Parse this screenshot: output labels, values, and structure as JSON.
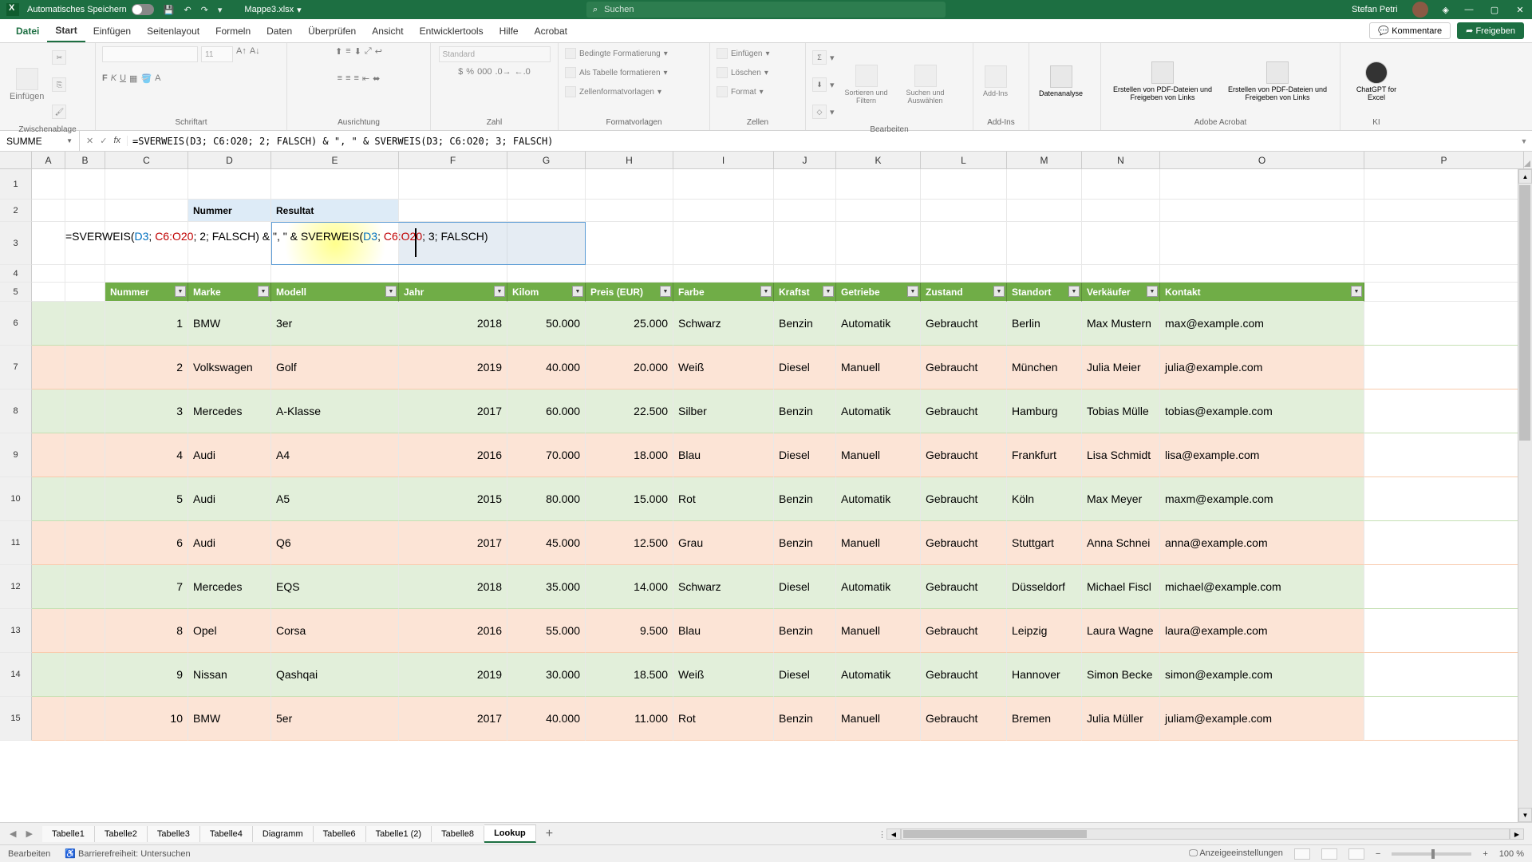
{
  "titlebar": {
    "autosave_label": "Automatisches Speichern",
    "filename": "Mappe3.xlsx",
    "search_placeholder": "Suchen",
    "user": "Stefan Petri"
  },
  "ribbon_tabs": {
    "file": "Datei",
    "start": "Start",
    "einfuegen": "Einfügen",
    "seitenlayout": "Seitenlayout",
    "formeln": "Formeln",
    "daten": "Daten",
    "ueberpruefen": "Überprüfen",
    "ansicht": "Ansicht",
    "entwickler": "Entwicklertools",
    "hilfe": "Hilfe",
    "acrobat": "Acrobat",
    "kommentare": "Kommentare",
    "freigeben": "Freigeben"
  },
  "ribbon": {
    "paste": "Einfügen",
    "group_zwischen": "Zwischenablage",
    "group_schrift": "Schriftart",
    "group_ausrichtung": "Ausrichtung",
    "group_zahl": "Zahl",
    "numfmt": "Standard",
    "fontsize": "11",
    "group_format": "Formatvorlagen",
    "cond1": "Bedingte Formatierung",
    "cond2": "Als Tabelle formatieren",
    "cond3": "Zellenformatvorlagen",
    "cells_ins": "Einfügen",
    "cells_del": "Löschen",
    "cells_fmt": "Format",
    "group_zellen": "Zellen",
    "sort": "Sortieren und Filtern",
    "find": "Suchen und Auswählen",
    "addins": "Add-Ins",
    "group_bearbeiten": "Bearbeiten",
    "group_addins": "Add-Ins",
    "dataanalyse": "Datenanalyse",
    "pdf1": "Erstellen von PDF-Dateien und Freigeben von Links",
    "pdf2": "Erstellen von PDF-Dateien und Freigeben von Links",
    "group_adobe": "Adobe Acrobat",
    "chatgpt": "ChatGPT for Excel",
    "group_ki": "KI"
  },
  "formula_row": {
    "name_box": "SUMME",
    "formula": "=SVERWEIS(D3; C6:O20; 2; FALSCH) & \", \" & SVERWEIS(D3; C6:O20; 3; FALSCH)"
  },
  "col_letters": [
    "A",
    "B",
    "C",
    "D",
    "E",
    "F",
    "G",
    "H",
    "I",
    "J",
    "K",
    "L",
    "M",
    "N",
    "O",
    "P"
  ],
  "row_headers": {
    "r2_d": "Nummer",
    "r2_e": "Resultat"
  },
  "formula_tokens": {
    "p1": "=SVERWEIS(",
    "d3a": "D3",
    "p2": "; ",
    "r1": "C6:O20",
    "p3": "; 2; FALSCH) & \", \" & SVERWEIS(",
    "d3b": "D3",
    "p4": "; ",
    "r2": "C6:O20",
    "p5": "; 3; FALSCH)"
  },
  "table_headers": {
    "c": "Nummer",
    "d": "Marke",
    "e": "Modell",
    "f": "Jahr",
    "g": "Kilom",
    "h": "Preis (EUR)",
    "i": "Farbe",
    "j": "Kraftst",
    "k": "Getriebe",
    "l": "Zustand",
    "m": "Standort",
    "n": "Verkäufer",
    "o": "Kontakt"
  },
  "table": [
    {
      "n": "1",
      "marke": "BMW",
      "modell": "3er",
      "jahr": "2018",
      "km": "50.000",
      "preis": "25.000",
      "farbe": "Schwarz",
      "kraft": "Benzin",
      "getriebe": "Automatik",
      "zustand": "Gebraucht",
      "ort": "Berlin",
      "verk": "Max Mustern",
      "kontakt": "max@example.com"
    },
    {
      "n": "2",
      "marke": "Volkswagen",
      "modell": "Golf",
      "jahr": "2019",
      "km": "40.000",
      "preis": "20.000",
      "farbe": "Weiß",
      "kraft": "Diesel",
      "getriebe": "Manuell",
      "zustand": "Gebraucht",
      "ort": "München",
      "verk": "Julia Meier",
      "kontakt": "julia@example.com"
    },
    {
      "n": "3",
      "marke": "Mercedes",
      "modell": "A-Klasse",
      "jahr": "2017",
      "km": "60.000",
      "preis": "22.500",
      "farbe": "Silber",
      "kraft": "Benzin",
      "getriebe": "Automatik",
      "zustand": "Gebraucht",
      "ort": "Hamburg",
      "verk": "Tobias Mülle",
      "kontakt": "tobias@example.com"
    },
    {
      "n": "4",
      "marke": "Audi",
      "modell": "A4",
      "jahr": "2016",
      "km": "70.000",
      "preis": "18.000",
      "farbe": "Blau",
      "kraft": "Diesel",
      "getriebe": "Manuell",
      "zustand": "Gebraucht",
      "ort": "Frankfurt",
      "verk": "Lisa Schmidt",
      "kontakt": "lisa@example.com"
    },
    {
      "n": "5",
      "marke": "Audi",
      "modell": "A5",
      "jahr": "2015",
      "km": "80.000",
      "preis": "15.000",
      "farbe": "Rot",
      "kraft": "Benzin",
      "getriebe": "Automatik",
      "zustand": "Gebraucht",
      "ort": "Köln",
      "verk": "Max Meyer",
      "kontakt": "maxm@example.com"
    },
    {
      "n": "6",
      "marke": "Audi",
      "modell": "Q6",
      "jahr": "2017",
      "km": "45.000",
      "preis": "12.500",
      "farbe": "Grau",
      "kraft": "Benzin",
      "getriebe": "Manuell",
      "zustand": "Gebraucht",
      "ort": "Stuttgart",
      "verk": "Anna Schnei",
      "kontakt": "anna@example.com"
    },
    {
      "n": "7",
      "marke": "Mercedes",
      "modell": "EQS",
      "jahr": "2018",
      "km": "35.000",
      "preis": "14.000",
      "farbe": "Schwarz",
      "kraft": "Diesel",
      "getriebe": "Automatik",
      "zustand": "Gebraucht",
      "ort": "Düsseldorf",
      "verk": "Michael Fiscl",
      "kontakt": "michael@example.com"
    },
    {
      "n": "8",
      "marke": "Opel",
      "modell": "Corsa",
      "jahr": "2016",
      "km": "55.000",
      "preis": "9.500",
      "farbe": "Blau",
      "kraft": "Benzin",
      "getriebe": "Manuell",
      "zustand": "Gebraucht",
      "ort": "Leipzig",
      "verk": "Laura Wagne",
      "kontakt": "laura@example.com"
    },
    {
      "n": "9",
      "marke": "Nissan",
      "modell": "Qashqai",
      "jahr": "2019",
      "km": "30.000",
      "preis": "18.500",
      "farbe": "Weiß",
      "kraft": "Diesel",
      "getriebe": "Automatik",
      "zustand": "Gebraucht",
      "ort": "Hannover",
      "verk": "Simon Becke",
      "kontakt": "simon@example.com"
    },
    {
      "n": "10",
      "marke": "BMW",
      "modell": "5er",
      "jahr": "2017",
      "km": "40.000",
      "preis": "11.000",
      "farbe": "Rot",
      "kraft": "Benzin",
      "getriebe": "Manuell",
      "zustand": "Gebraucht",
      "ort": "Bremen",
      "verk": "Julia Müller",
      "kontakt": "juliam@example.com"
    }
  ],
  "sheets": {
    "t1": "Tabelle1",
    "t2": "Tabelle2",
    "t3": "Tabelle3",
    "t4": "Tabelle4",
    "t5": "Diagramm",
    "t6": "Tabelle6",
    "t7": "Tabelle1 (2)",
    "t8": "Tabelle8",
    "t9": "Lookup"
  },
  "statusbar": {
    "mode": "Bearbeiten",
    "access": "Barrierefreiheit: Untersuchen",
    "display": "Anzeigeeinstellungen",
    "zoom": "100 %"
  }
}
